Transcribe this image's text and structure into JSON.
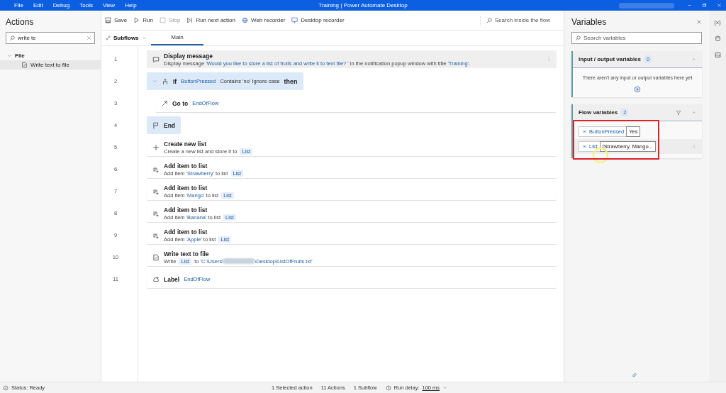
{
  "window": {
    "title": "Training | Power Automate Desktop"
  },
  "menu": [
    "File",
    "Edit",
    "Debug",
    "Tools",
    "View",
    "Help"
  ],
  "actions_panel": {
    "title": "Actions",
    "search": {
      "value": "write te"
    },
    "tree": [
      {
        "label": "File",
        "expanded": true,
        "children": [
          {
            "label": "Write text to file",
            "selected": true
          }
        ]
      }
    ]
  },
  "toolbar": [
    {
      "label": "Save",
      "kind": "save",
      "disabled": false
    },
    {
      "label": "Run",
      "kind": "run",
      "disabled": false
    },
    {
      "label": "Stop",
      "kind": "stop",
      "disabled": true
    },
    {
      "label": "Run next action",
      "kind": "next",
      "disabled": false
    },
    {
      "label": "Web recorder",
      "kind": "web",
      "disabled": false
    },
    {
      "label": "Desktop recorder",
      "kind": "desktop",
      "disabled": false
    }
  ],
  "flow_search": {
    "placeholder": "Search inside the flow"
  },
  "subflows": {
    "label": "Subflows"
  },
  "tabs": [
    {
      "label": "Main",
      "selected": true
    }
  ],
  "steps": [
    {
      "number": "1",
      "kind": "message",
      "title": "Display message",
      "selected": true,
      "highlighted": false,
      "indented": false,
      "description": [
        {
          "kind": "plain",
          "text": "Display message "
        },
        {
          "kind": "literal",
          "text": "'Would you like to store a list of fruits and write it to text file? '"
        },
        {
          "kind": "plain",
          "text": " in the notification popup window with title "
        },
        {
          "kind": "literal",
          "text": "'Training'"
        },
        {
          "kind": "plain",
          "text": "."
        }
      ]
    },
    {
      "number": "2",
      "kind": "if",
      "title": "If",
      "selected": false,
      "highlighted": true,
      "indented": false,
      "expanded": true,
      "inline": [
        {
          "kind": "literal",
          "text": "ButtonPressed"
        },
        {
          "kind": "plain",
          "text": "Contains 'no' Ignore case"
        },
        {
          "kind": "keyword",
          "text": "then"
        }
      ]
    },
    {
      "number": "3",
      "kind": "goto",
      "title": "Go to",
      "selected": false,
      "highlighted": false,
      "indented": true,
      "inline": [
        {
          "kind": "literal",
          "text": "EndOfFlow"
        }
      ]
    },
    {
      "number": "4",
      "kind": "end",
      "title": "End",
      "selected": false,
      "highlighted": true,
      "indented": false
    },
    {
      "number": "5",
      "kind": "plus",
      "title": "Create new list",
      "selected": false,
      "highlighted": false,
      "indented": false,
      "description": [
        {
          "kind": "plain",
          "text": "Create a new list and store it to "
        },
        {
          "kind": "variable",
          "text": "List"
        }
      ]
    },
    {
      "number": "6",
      "kind": "additem",
      "title": "Add item to list",
      "selected": false,
      "highlighted": false,
      "indented": false,
      "description": [
        {
          "kind": "plain",
          "text": "Add item "
        },
        {
          "kind": "literal",
          "text": "'Strawberry'"
        },
        {
          "kind": "plain",
          "text": " to list "
        },
        {
          "kind": "variable",
          "text": "List"
        }
      ]
    },
    {
      "number": "7",
      "kind": "additem",
      "title": "Add item to list",
      "selected": false,
      "highlighted": false,
      "indented": false,
      "description": [
        {
          "kind": "plain",
          "text": "Add item "
        },
        {
          "kind": "literal",
          "text": "'Mango'"
        },
        {
          "kind": "plain",
          "text": " to list "
        },
        {
          "kind": "variable",
          "text": "List"
        }
      ]
    },
    {
      "number": "8",
      "kind": "additem",
      "title": "Add item to list",
      "selected": false,
      "highlighted": false,
      "indented": false,
      "description": [
        {
          "kind": "plain",
          "text": "Add item "
        },
        {
          "kind": "literal",
          "text": "'Banana'"
        },
        {
          "kind": "plain",
          "text": " to list "
        },
        {
          "kind": "variable",
          "text": "List"
        }
      ]
    },
    {
      "number": "9",
      "kind": "additem",
      "title": "Add item to list",
      "selected": false,
      "highlighted": false,
      "indented": false,
      "description": [
        {
          "kind": "plain",
          "text": "Add item "
        },
        {
          "kind": "literal",
          "text": "'Apple'"
        },
        {
          "kind": "plain",
          "text": " to list "
        },
        {
          "kind": "variable",
          "text": "List"
        }
      ]
    },
    {
      "number": "10",
      "kind": "write",
      "title": "Write text to file",
      "selected": false,
      "highlighted": false,
      "indented": false,
      "description": [
        {
          "kind": "plain",
          "text": "Write "
        },
        {
          "kind": "variable",
          "text": "List"
        },
        {
          "kind": "plain",
          "text": " to "
        },
        {
          "kind": "literal",
          "text": "'C:\\Users\\"
        },
        {
          "kind": "redacted"
        },
        {
          "kind": "literal",
          "text": "\\Desktop\\ListOfFruits.txt'"
        }
      ]
    },
    {
      "number": "11",
      "kind": "label",
      "title": "Label",
      "selected": false,
      "highlighted": false,
      "indented": false,
      "inline": [
        {
          "kind": "literal",
          "text": "EndOfFlow"
        }
      ]
    }
  ],
  "variables_panel": {
    "title": "Variables",
    "search": {
      "placeholder": "Search variables"
    },
    "sections": [
      {
        "title": "Input / output variables",
        "count": "0",
        "expanded": true,
        "filter": false,
        "empty_text": "There aren't any input or output variables here yet"
      },
      {
        "title": "Flow variables",
        "count": "2",
        "expanded": true,
        "filter": true,
        "variables": [
          {
            "name": "ButtonPressed",
            "value": "Yes",
            "hovered": false
          },
          {
            "name": "List",
            "value": "[Strawberry, Mango...",
            "hovered": true
          }
        ]
      }
    ]
  },
  "side_strip": [
    {
      "kind": "text",
      "text": "{x}"
    },
    {
      "kind": "database"
    },
    {
      "kind": "image"
    }
  ],
  "status_bar": {
    "status": "Status: Ready",
    "selected": "1 Selected action",
    "actions": "11 Actions",
    "subflows": "1 Subflow",
    "run_delay_label": "Run delay:",
    "run_delay": "100 ms"
  }
}
